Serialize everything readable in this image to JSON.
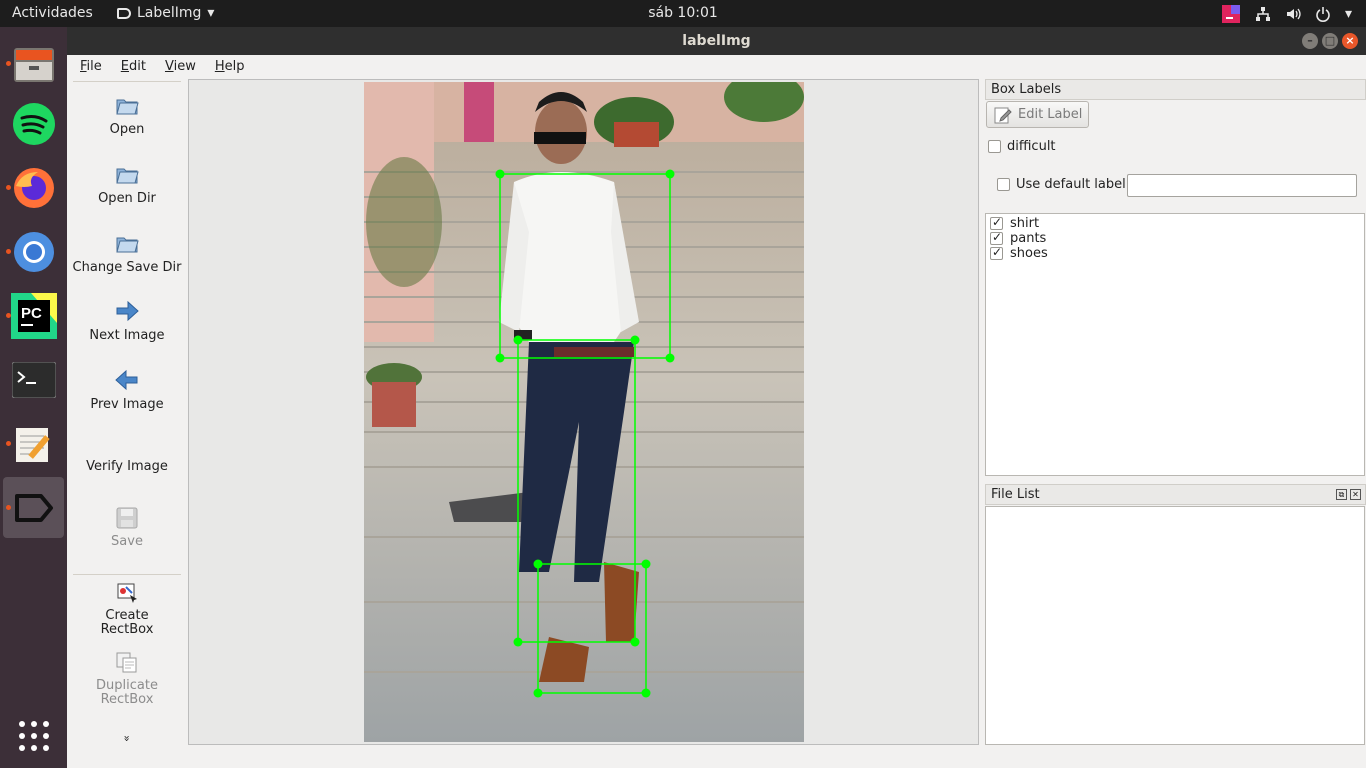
{
  "topbar": {
    "activities": "Actividades",
    "app_name": "LabelImg",
    "clock": "sáb 10:01"
  },
  "dock": {
    "items": [
      "files-icon",
      "spotify-icon",
      "firefox-icon",
      "chromium-icon",
      "pycharm-icon",
      "terminal-icon",
      "text-editor-icon",
      "labelimg-icon"
    ],
    "show_apps": "apps-grid-icon"
  },
  "window": {
    "title": "labelImg"
  },
  "menubar": {
    "items": [
      "File",
      "Edit",
      "View",
      "Help"
    ]
  },
  "toolbar": {
    "open": "Open",
    "open_dir": "Open Dir",
    "change_save_dir": "Change Save Dir",
    "next_image": "Next Image",
    "prev_image": "Prev Image",
    "verify_image": "Verify Image",
    "save": "Save",
    "create_rectbox_1": "Create",
    "create_rectbox_2": "RectBox",
    "duplicate_rectbox_1": "Duplicate",
    "duplicate_rectbox_2": "RectBox",
    "more": "»"
  },
  "box_labels": {
    "title": "Box Labels",
    "edit_label": "Edit Label",
    "difficult": "difficult",
    "use_default_label": "Use default label",
    "default_label_value": "",
    "labels": [
      {
        "name": "shirt",
        "checked": true
      },
      {
        "name": "pants",
        "checked": true
      },
      {
        "name": "shoes",
        "checked": true
      }
    ]
  },
  "file_list": {
    "title": "File List",
    "files": []
  },
  "colors": {
    "box": "#00ff00",
    "dock_bg": "#3c2f38",
    "accent": "#e95420"
  }
}
